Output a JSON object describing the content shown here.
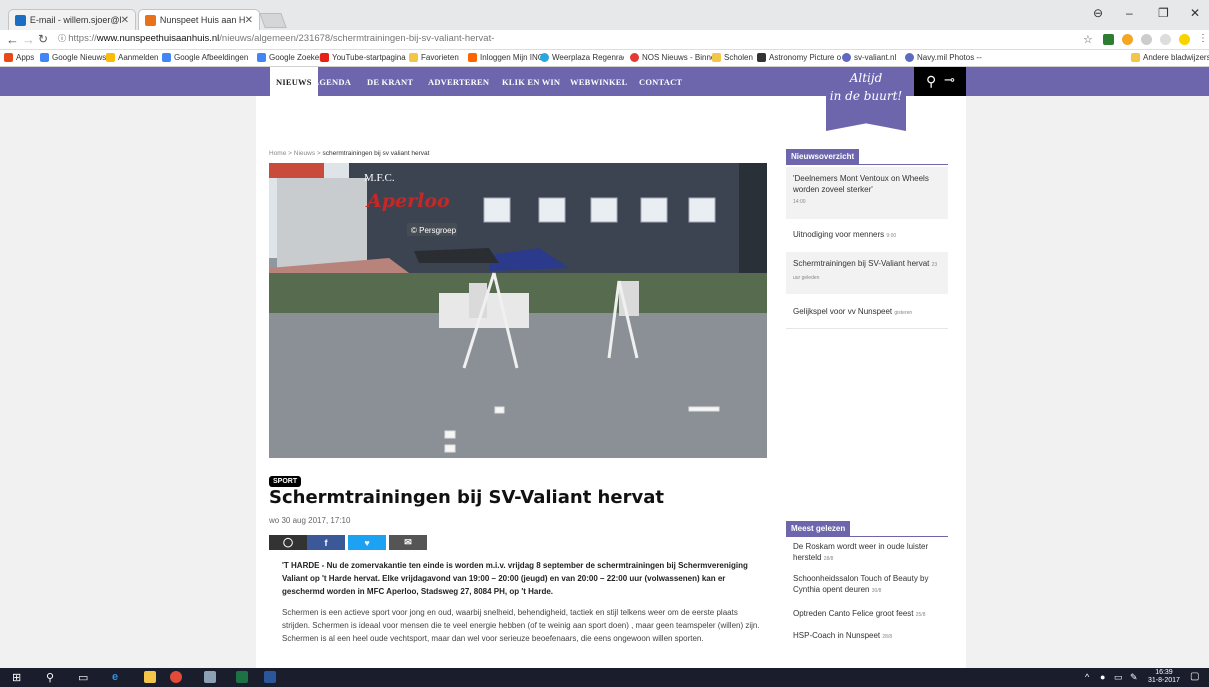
{
  "browser": {
    "tabs": [
      {
        "title": "E-mail - willem.sjoer@h",
        "active": false
      },
      {
        "title": "Nunspeet Huis aan Huis",
        "active": true
      }
    ],
    "url_secure": "https://",
    "url_domain": "www.nunspeethuisaanhuis.nl",
    "url_path": "/nieuws/algemeen/231678/schermtrainingen-bij-sv-valiant-hervat-",
    "bookmarks": [
      "Apps",
      "Google Nieuws",
      "Aanmelden",
      "Google Afbeeldingen",
      "Google Zoeken",
      "YouTube-startpagina",
      "Favorieten",
      "Inloggen Mijn ING",
      "Weerplaza Regenrad",
      "NOS Nieuws - Binne",
      "Scholen",
      "Astronomy Picture o",
      "sv-valiant.nl",
      "Navy.mil Photos -- E"
    ],
    "other_bookmarks": "Andere bladwijzers"
  },
  "site": {
    "nav": [
      "NIEUWS",
      "AGENDA",
      "DE KRANT",
      "ADVERTEREN",
      "KLIK EN WIN",
      "WEBWINKEL",
      "CONTACT"
    ],
    "slogan_1": "Altijd",
    "slogan_2": "in de buurt!"
  },
  "article": {
    "crumb_home": "Home",
    "crumb_news": "Nieuws",
    "crumb_current": "schermtrainingen bij sv valiant hervat",
    "photo_sign_top": "M.F.C.",
    "photo_sign_brand": "Aperloo",
    "photo_credit": "© Persgroep",
    "tag": "SPORT",
    "title": "Schermtrainingen bij SV-Valiant hervat",
    "date": "wo 30 aug 2017, 17:10",
    "lead": "'T HARDE - Nu de zomervakantie ten einde is worden m.i.v. vrijdag 8 september de schermtrainingen bij Schermvereniging Valiant op 't Harde hervat. Elke vrijdagavond van 19:00 – 20:00 (jeugd) en van 20:00 – 22:00 uur (volwassenen) kan er geschermd worden in MFC Aperloo, Stadsweg 27, 8084 PH, op 't Harde.",
    "body": "Schermen is een actieve sport voor jong en oud, waarbij snelheid, behendigheid, tactiek en stijl telkens weer om de eerste plaats strijden. Schermen is ideaal voor mensen die te veel energie hebben (of te weinig aan sport doen) , maar geen teamspeler (willen) zijn. Schermen is al een heel oude vechtsport, maar dan wel voor serieuze beoefenaars, die eens ongewoon willen sporten."
  },
  "sidebar": {
    "overview_title": "Nieuwsoverzicht",
    "overview": [
      {
        "title": "'Deelnemers Mont Ventoux on Wheels worden zoveel sterker'",
        "time": "14:00"
      },
      {
        "title": "Uitnodiging voor menners",
        "time": "9:00"
      },
      {
        "title": "Schermtrainingen bij SV-Valiant hervat",
        "time": "23 uur geleden"
      },
      {
        "title": "Gelijkspel voor vv Nunspeet",
        "time": "gisteren"
      }
    ],
    "popular_title": "Meest gelezen",
    "popular": [
      {
        "title": "De Roskam wordt weer in oude luister hersteld",
        "time": "28/8"
      },
      {
        "title": "Schoonheidssalon Touch of Beauty by Cynthia opent deuren",
        "time": "30/8"
      },
      {
        "title": "Optreden Canto Felice groot feest",
        "time": "25/8"
      },
      {
        "title": "HSP-Coach in Nunspeet",
        "time": "28/8"
      }
    ]
  },
  "taskbar": {
    "time": "16:39",
    "date": "31-8-2017"
  },
  "colors": {
    "brand": "#6d66ad",
    "facebook": "#3b5998",
    "twitter": "#1da1f2",
    "share_dark": "#333333"
  }
}
